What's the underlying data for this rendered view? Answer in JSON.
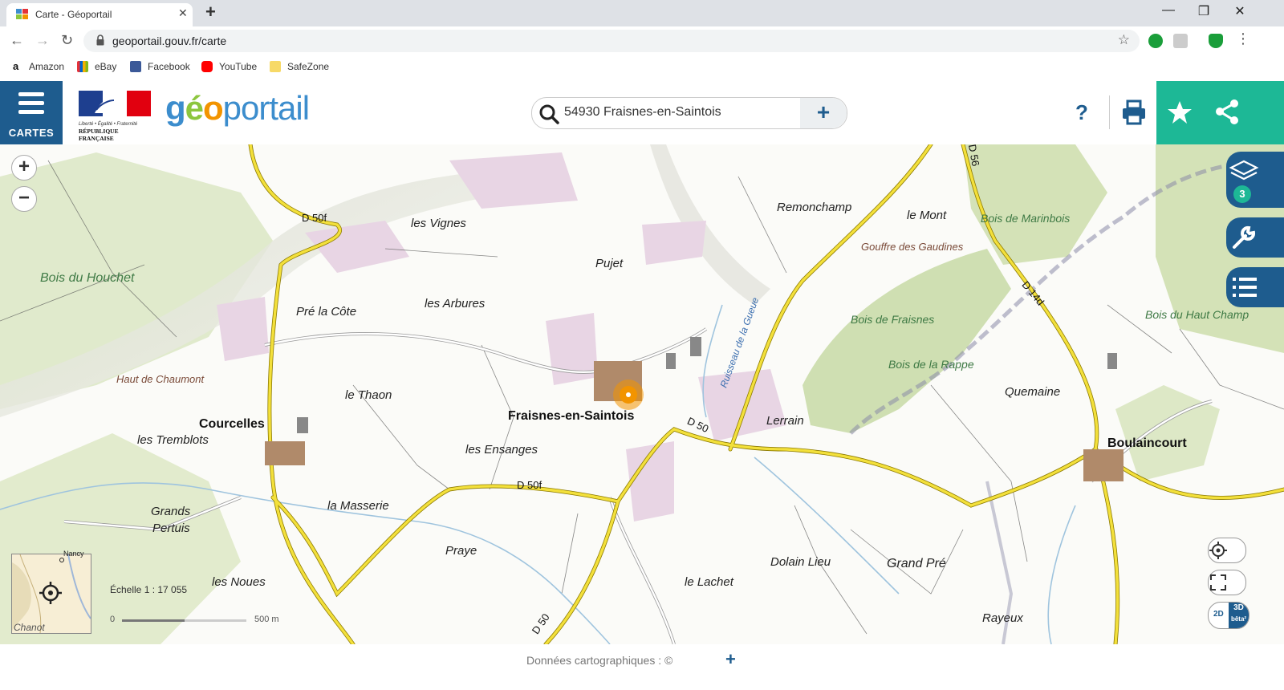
{
  "browser": {
    "tab_title": "Carte - Géoportail",
    "tab_close": "✕",
    "new_tab": "+",
    "url": "geoportail.gouv.fr/carte",
    "window_controls": {
      "minimize": "—",
      "restore": "❐",
      "close": "✕"
    },
    "nav": {
      "back": "←",
      "forward": "→",
      "reload": "↻"
    },
    "bookmarks": [
      {
        "label": "Amazon",
        "icon": "amazon-icon",
        "color": "#111111"
      },
      {
        "label": "eBay",
        "icon": "ebay-icon",
        "color": "#e53238"
      },
      {
        "label": "Facebook",
        "icon": "facebook-icon",
        "color": "#3b5998"
      },
      {
        "label": "YouTube",
        "icon": "youtube-icon",
        "color": "#ff0000"
      },
      {
        "label": "SafeZone",
        "icon": "folder-icon",
        "color": "#f7d967"
      }
    ]
  },
  "header": {
    "cartes_label": "CARTES",
    "rf_logo_text": {
      "line1": "Liberté • Égalité • Fraternité",
      "line2": "RÉPUBLIQUE FRANÇAISE"
    },
    "logo_parts": {
      "g": "g",
      "e": "é",
      "o": "o",
      "rest": "portail"
    },
    "search_value": "54930 Fraisnes-en-Saintois",
    "search_plus": "+",
    "help_label": "?",
    "colors": {
      "brand_blue": "#1e5c8e",
      "teal": "#1db896",
      "orange": "#f29400",
      "logo_blue": "#3c8dcd",
      "logo_green": "#8cc63e"
    }
  },
  "map": {
    "zoom_in": "+",
    "zoom_out": "−",
    "layers_count": "3",
    "scale_text": "Échelle 1 : 17 055",
    "scale_start": "0",
    "scale_end": "500 m",
    "mode_2d": "2D",
    "mode_3d": "3D",
    "mode_beta": "bêta²",
    "minimap_label": "Nancy",
    "minimap_label2": "Chanot"
  },
  "footer": {
    "attribution": "Données cartographiques : ©",
    "plus": "+"
  }
}
